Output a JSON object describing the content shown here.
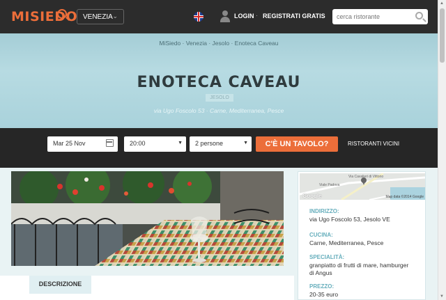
{
  "header": {
    "logo": "MISIEDO",
    "city": "VENEZIA",
    "login": "LOGIN",
    "separator": "·",
    "register": "REGISTRATI GRATIS",
    "search_placeholder": "cerca ristorante"
  },
  "hero": {
    "breadcrumb": "MiSiedo · Venezia · Jesolo · Enoteca Caveau",
    "title": "ENOTECA CAVEAU",
    "zone": "JESOLO",
    "address_line": "via Ugo Foscolo 53 · Carne, Mediterranea, Pesce"
  },
  "booking": {
    "date": "Mar 25 Nov",
    "time": "20:00",
    "people": "2 persone",
    "cta": "C'È UN TAVOLO?",
    "nearby": "RISTORANTI VICINI"
  },
  "tabs": {
    "description": "DESCRIZIONE"
  },
  "map": {
    "street1": "Viale Padova",
    "street2": "Via Cavalieri di Vittorio",
    "google": "Google",
    "attribution": "Map data ©2014 Google"
  },
  "info": {
    "address_label": "INDIRIZZO:",
    "address_value": "via Ugo Foscolo 53, Jesolo VE",
    "cuisine_label": "CUCINA:",
    "cuisine_value": "Carne, Mediterranea, Pesce",
    "specialty_label": "SPECIALITÀ:",
    "specialty_value": "granpiatto di frutti di mare, hamburger di Angus",
    "price_label": "PREZZO:",
    "price_value": "20-35 euro"
  },
  "colors": {
    "brand": "#ec6e3a",
    "header_bg": "#2c2c2c",
    "hero_bg": "#a9d2db",
    "label_teal": "#66aebc"
  }
}
